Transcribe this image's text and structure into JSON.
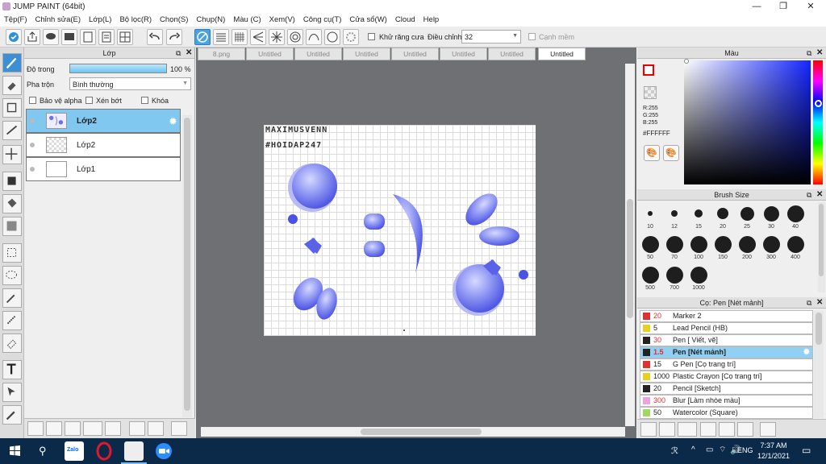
{
  "window": {
    "title": "JUMP PAINT (64bit)"
  },
  "menu": [
    "Tệp(F)",
    "Chỉnh sửa(E)",
    "Lớp(L)",
    "Bộ lọc(R)",
    "Chọn(S)",
    "Chụp(N)",
    "Màu (C)",
    "Xem(V)",
    "Công cụ(T)",
    "Cửa sổ(W)",
    "Cloud",
    "Help"
  ],
  "toolbar": {
    "antialias_label": "Khử răng cưa",
    "adjust_label": "Điều chỉnh",
    "adjust_value": "32",
    "smooth_label": "Cạnh mềm"
  },
  "layers": {
    "title": "Lớp",
    "opacity_label": "Độ trong",
    "opacity_value": "100 %",
    "opacity_fraction": 1.0,
    "blend_label": "Pha trộn",
    "blend_value": "Bình thường",
    "protect_alpha": "Bảo vệ alpha",
    "clip": "Xén bớt",
    "lock": "Khóa",
    "items": [
      {
        "name": "Lớp2",
        "selected": true
      },
      {
        "name": "Lớp2",
        "selected": false
      },
      {
        "name": "Lớp1",
        "selected": false
      }
    ]
  },
  "tabs": [
    "8.png",
    "Untitled",
    "Untitled",
    "Untitled",
    "Untitled",
    "Untitled",
    "Untitled",
    "Untitled"
  ],
  "canvas": {
    "text_line1": "MAXIMUSVENN",
    "text_line2": "#HOIDAP247"
  },
  "color": {
    "title": "Màu",
    "r": "R:255",
    "g": "G:255",
    "b": "B:255",
    "hex": "#FFFFFF",
    "primary": "#FF0000"
  },
  "brush_size": {
    "title": "Brush Size",
    "sizes": [
      "10",
      "12",
      "15",
      "20",
      "25",
      "30",
      "40",
      "50",
      "70",
      "100",
      "150",
      "200",
      "300",
      "400",
      "500",
      "700",
      "1000"
    ]
  },
  "brushes": {
    "title": "Cọ: Pen [Nét mảnh]",
    "items": [
      {
        "size": "20",
        "name": "Marker 2",
        "color": "#e03030",
        "size_color": "#e03030"
      },
      {
        "size": "5",
        "name": "Lead Pencil (HB)",
        "color": "#e8d020",
        "size_color": "#222"
      },
      {
        "size": "30",
        "name": "Pen [ Viết, vẽ]",
        "color": "#222222",
        "size_color": "#e03030"
      },
      {
        "size": "1.5",
        "name": "Pen [Nét mảnh]",
        "color": "#222222",
        "size_color": "#e03030",
        "selected": true
      },
      {
        "size": "15",
        "name": "G Pen [Cọ trang trí]",
        "color": "#e03030",
        "size_color": "#222"
      },
      {
        "size": "1000",
        "name": "Plastic Crayon [Cọ trang trí]",
        "color": "#e8d020",
        "size_color": "#222"
      },
      {
        "size": "20",
        "name": "Pencil [Sketch]",
        "color": "#222222",
        "size_color": "#222"
      },
      {
        "size": "300",
        "name": "Blur [Làm nhòe màu]",
        "color": "#f0a0e0",
        "size_color": "#e03030"
      },
      {
        "size": "50",
        "name": "Watercolor (Square)",
        "color": "#a0d860",
        "size_color": "#222"
      }
    ]
  },
  "taskbar": {
    "time": "7:37 AM",
    "date": "12/1/2021",
    "lang": "ENG"
  }
}
